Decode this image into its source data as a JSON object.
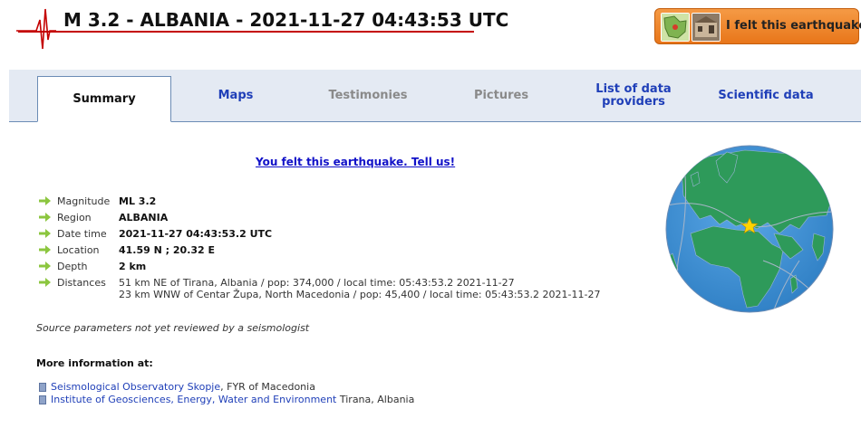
{
  "header": {
    "title": "M 3.2 - ALBANIA - 2021-11-27 04:43:53 UTC",
    "felt_button_label": "I felt this earthquake",
    "icons": [
      "seismogram-icon"
    ]
  },
  "tabs": [
    {
      "label": "Summary",
      "state": "active"
    },
    {
      "label": "Maps",
      "state": "enabled"
    },
    {
      "label": "Testimonies",
      "state": "disabled"
    },
    {
      "label": "Pictures",
      "state": "disabled"
    },
    {
      "label": "List of data providers",
      "state": "enabled"
    },
    {
      "label": "Scientific data",
      "state": "enabled"
    }
  ],
  "tell_us_link": "You felt this earthquake. Tell us!",
  "params": {
    "magnitude": {
      "label": "Magnitude",
      "value": "ML 3.2"
    },
    "region": {
      "label": "Region",
      "value": "ALBANIA"
    },
    "datetime": {
      "label": "Date time",
      "value": "2021-11-27 04:43:53.2 UTC"
    },
    "location": {
      "label": "Location",
      "value": "41.59 N ; 20.32 E"
    },
    "depth": {
      "label": "Depth",
      "value": "2 km"
    },
    "distances": {
      "label": "Distances",
      "lines": [
        "51 km NE of Tirana, Albania / pop: 374,000 / local time: 05:43:53.2 2021-11-27",
        "23 km WNW of Centar Župa, North Macedonia / pop: 45,400 / local time: 05:43:53.2 2021-11-27"
      ]
    }
  },
  "review_note": "Source parameters not yet reviewed by a seismologist",
  "more_info": {
    "title": "More information at:",
    "links": [
      {
        "link_text": "Seismological Observatory Skopje",
        "suffix": ", FYR of Macedonia"
      },
      {
        "link_text": "Institute of Geosciences, Energy, Water and Environment",
        "suffix": " Tirana, Albania"
      }
    ]
  },
  "colors": {
    "accent_link": "#1f3fb8",
    "title_underline": "#c40000",
    "felt_button": "#e8761a",
    "tab_bar": "#e4eaf3",
    "arrow": "#8cc63f",
    "ocean": "#3b8fd4",
    "land": "#2e9a5a",
    "epicenter_star": "#ffd400"
  }
}
